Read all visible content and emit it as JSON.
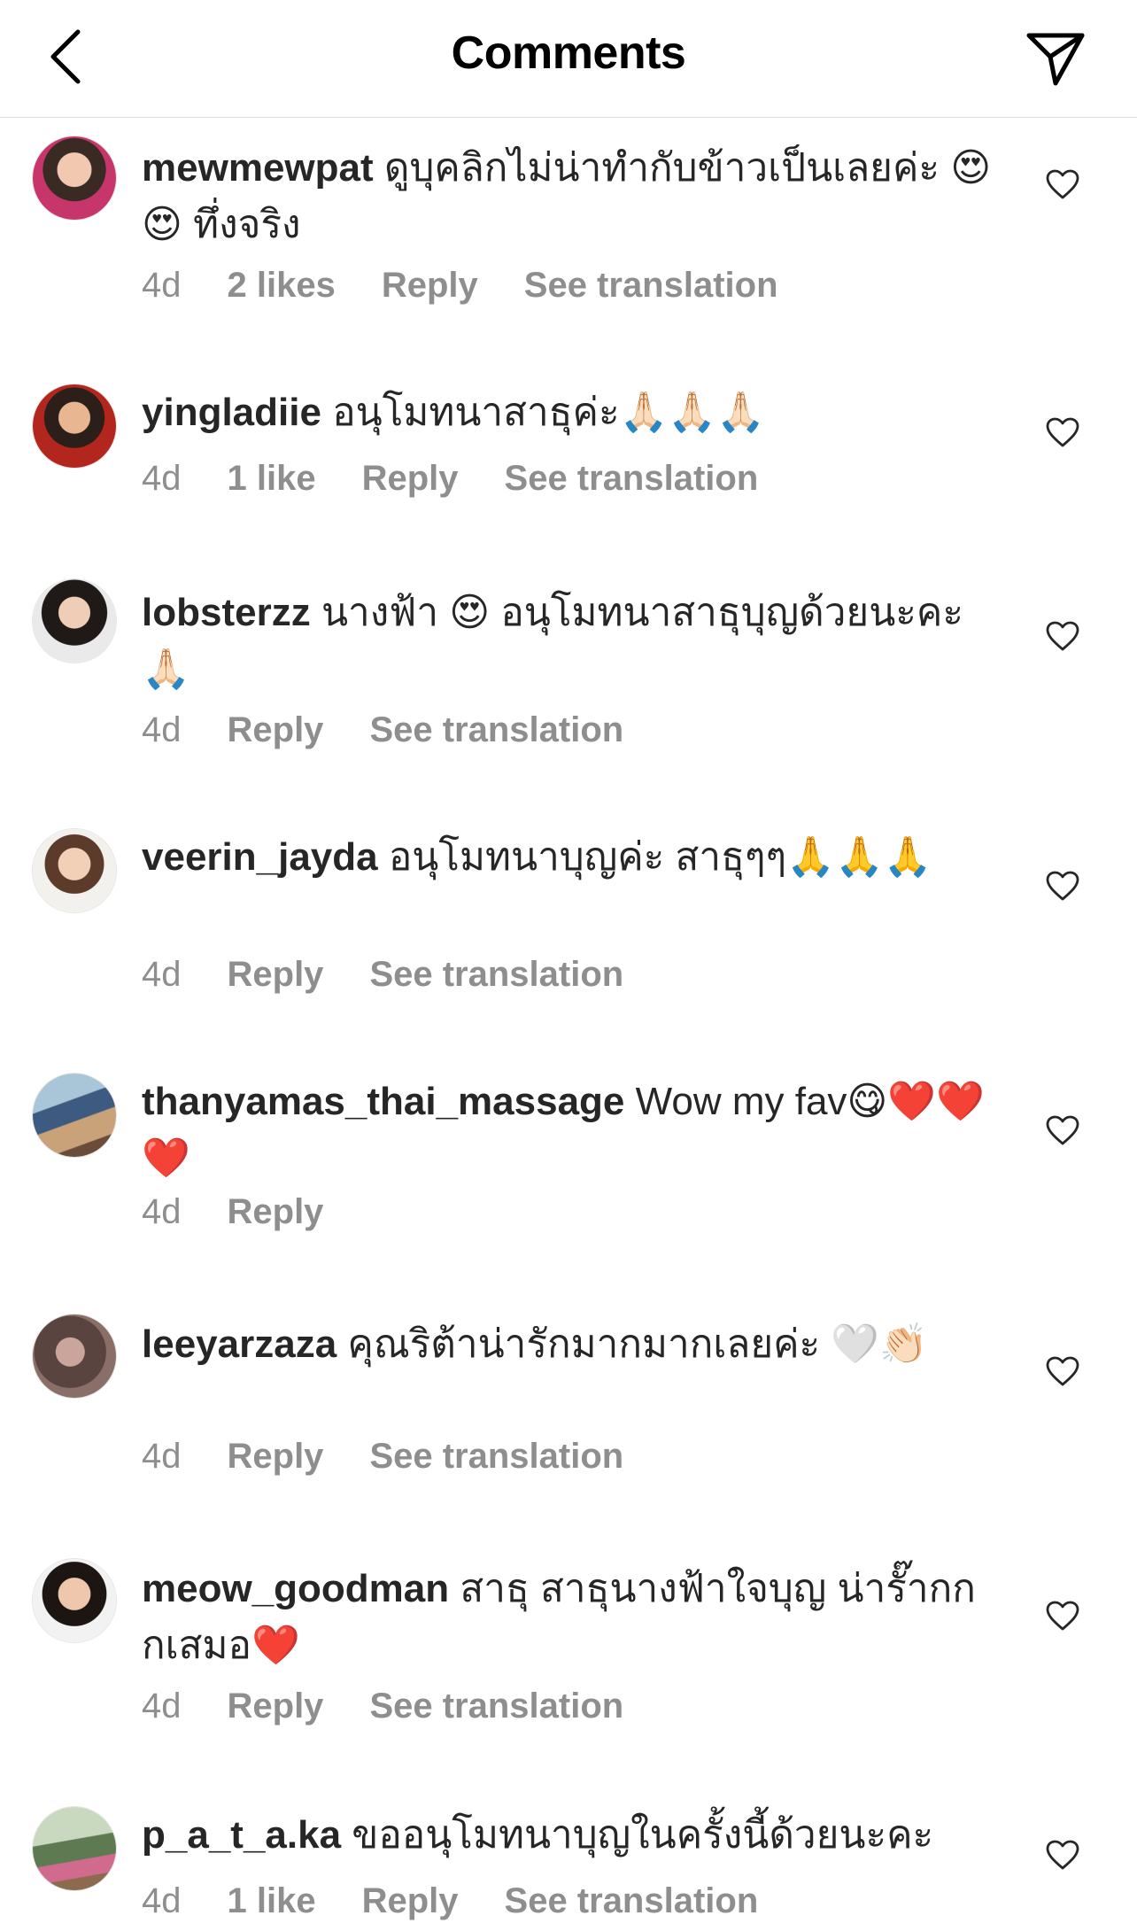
{
  "header": {
    "title": "Comments",
    "back_icon": "chevron-left-icon",
    "send_icon": "paper-plane-icon"
  },
  "colors": {
    "text": "#262626",
    "muted": "#8e8e8e",
    "divider": "#dbdbdb"
  },
  "comments": [
    {
      "username": "mewmewpat",
      "text": "ดูบุคลิกไม่น่าทำกับข้าวเป็นเลยค่ะ 😍 😍 ทึ่งจริง",
      "time": "4d",
      "likes": "2 likes",
      "reply": "Reply",
      "translation": "See translation"
    },
    {
      "username": "yingladiie",
      "text": "อนุโมทนาสาธุค่ะ🙏🏻🙏🏻🙏🏻",
      "time": "4d",
      "likes": "1 like",
      "reply": "Reply",
      "translation": "See translation"
    },
    {
      "username": "lobsterzz",
      "text": "นางฟ้า 😍 อนุโมทนาสาธุบุญด้วยนะคะ 🙏🏻",
      "time": "4d",
      "likes": "",
      "reply": "Reply",
      "translation": "See translation"
    },
    {
      "username": "veerin_jayda",
      "text": "อนุโมทนาบุญค่ะ สาธุๆๆ🙏🙏🙏",
      "time": "4d",
      "likes": "",
      "reply": "Reply",
      "translation": "See translation"
    },
    {
      "username": "thanyamas_thai_massage",
      "text": "Wow my fav😋❤️❤️❤️",
      "time": "4d",
      "likes": "",
      "reply": "Reply",
      "translation": ""
    },
    {
      "username": "leeyarzaza",
      "text": "คุณริต้าน่ารักมากมากเลยค่ะ 🤍👏🏻",
      "time": "4d",
      "likes": "",
      "reply": "Reply",
      "translation": "See translation"
    },
    {
      "username": "meow_goodman",
      "text": "สาธุ สาธุนางฟ้าใจบุญ น่ารั๊ากกกเสมอ❤️",
      "time": "4d",
      "likes": "",
      "reply": "Reply",
      "translation": "See translation"
    },
    {
      "username": "p_a_t_a.ka",
      "text": "ขออนุโมทนาบุญในครั้งนี้ด้วยนะคะ",
      "time": "4d",
      "likes": "1 like",
      "reply": "Reply",
      "translation": "See translation"
    }
  ]
}
